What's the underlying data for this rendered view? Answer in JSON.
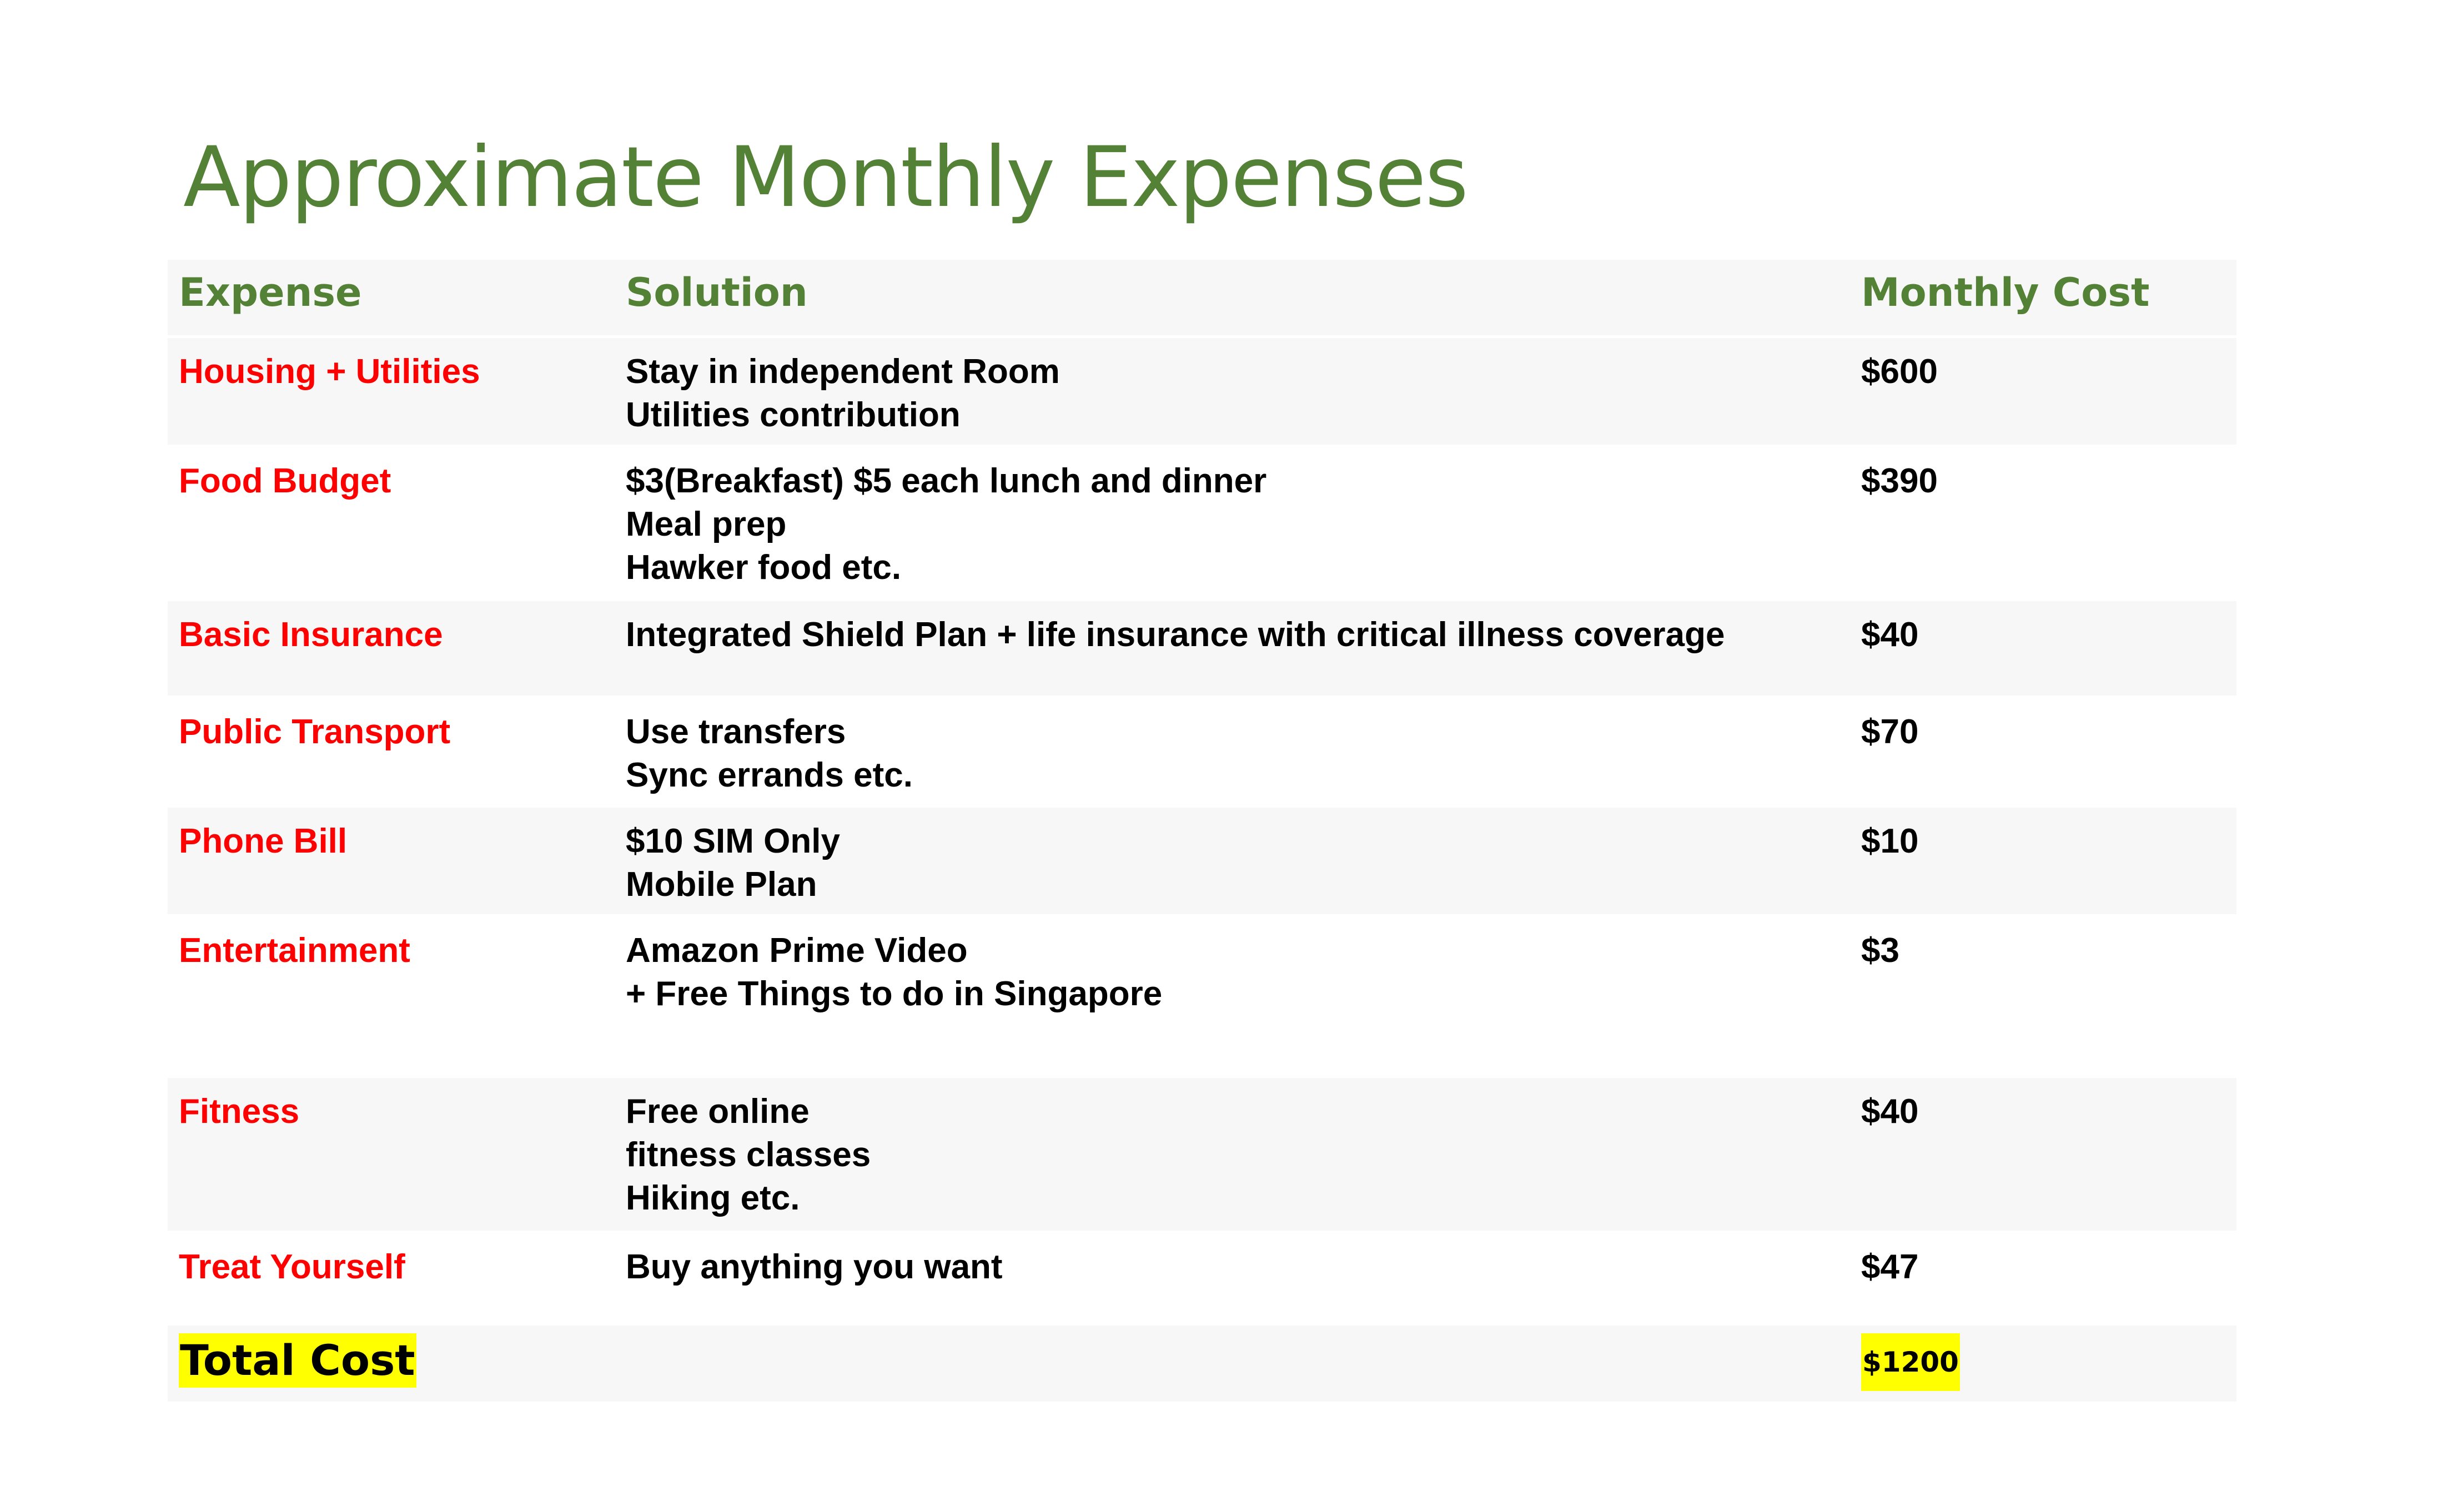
{
  "title": "Approximate Monthly Expenses",
  "colors": {
    "title": "#538135",
    "header": "#538135",
    "expense_name": "#ff0000",
    "body_text": "#000000",
    "highlight": "#ffff00",
    "row_band": "#f7f7f7"
  },
  "table": {
    "headers": {
      "expense": "Expense",
      "solution": "Solution",
      "monthly_cost": "Monthly Cost"
    },
    "rows": [
      {
        "expense": "Housing + Utilities",
        "solution": [
          "Stay in independent Room",
          "Utilities contribution"
        ],
        "cost": "$600"
      },
      {
        "expense": "Food Budget",
        "solution": [
          "$3(Breakfast) $5 each lunch and dinner",
          "Meal prep",
          "Hawker food etc."
        ],
        "cost": "$390"
      },
      {
        "expense": "Basic Insurance",
        "solution": [
          "Integrated Shield Plan + life insurance with critical illness coverage"
        ],
        "cost": "$40"
      },
      {
        "expense": "Public Transport",
        "solution": [
          "Use transfers",
          "Sync errands etc."
        ],
        "cost": "$70"
      },
      {
        "expense": "Phone Bill",
        "solution": [
          "$10 SIM Only",
          "Mobile Plan"
        ],
        "cost": "$10"
      },
      {
        "expense": "Entertainment",
        "solution": [
          "Amazon Prime Video",
          "+ Free Things to do in Singapore"
        ],
        "cost": "$3"
      },
      {
        "expense": "Fitness",
        "solution": [
          "Free online",
          "fitness classes",
          "Hiking etc."
        ],
        "cost": "$40"
      },
      {
        "expense": "Treat Yourself",
        "solution": [
          "Buy anything you want"
        ],
        "cost": "$47"
      }
    ],
    "total": {
      "label": "Total Cost",
      "value": "$1200"
    }
  }
}
